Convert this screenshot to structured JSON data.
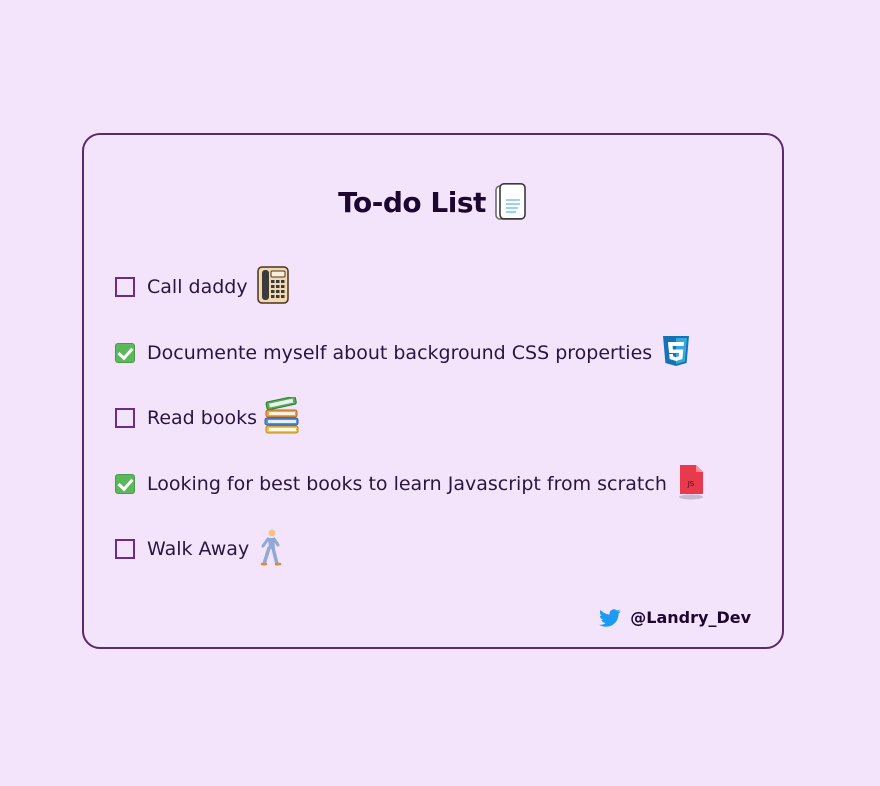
{
  "title": "To-do List",
  "title_icon": "memo-notepad-icon",
  "items": [
    {
      "label": "Call daddy",
      "checked": false,
      "icon": "telephone-icon"
    },
    {
      "label": "Documente myself about background CSS properties",
      "checked": true,
      "icon": "css3-icon"
    },
    {
      "label": "Read books",
      "checked": false,
      "icon": "books-icon"
    },
    {
      "label": "Looking for best books to learn Javascript from scratch",
      "checked": true,
      "icon": "js-file-icon"
    },
    {
      "label": "Walk Away",
      "checked": false,
      "icon": "walking-person-icon"
    }
  ],
  "footer": {
    "icon": "twitter-bird-icon",
    "handle": "@Landry_Dev"
  },
  "colors": {
    "background": "#f4e4fb",
    "border": "#5a2a6e",
    "text": "#1d0730",
    "checkbox_border": "#6a2c8a",
    "check_green": "#5cb85c",
    "twitter_blue": "#1d9bf0"
  }
}
